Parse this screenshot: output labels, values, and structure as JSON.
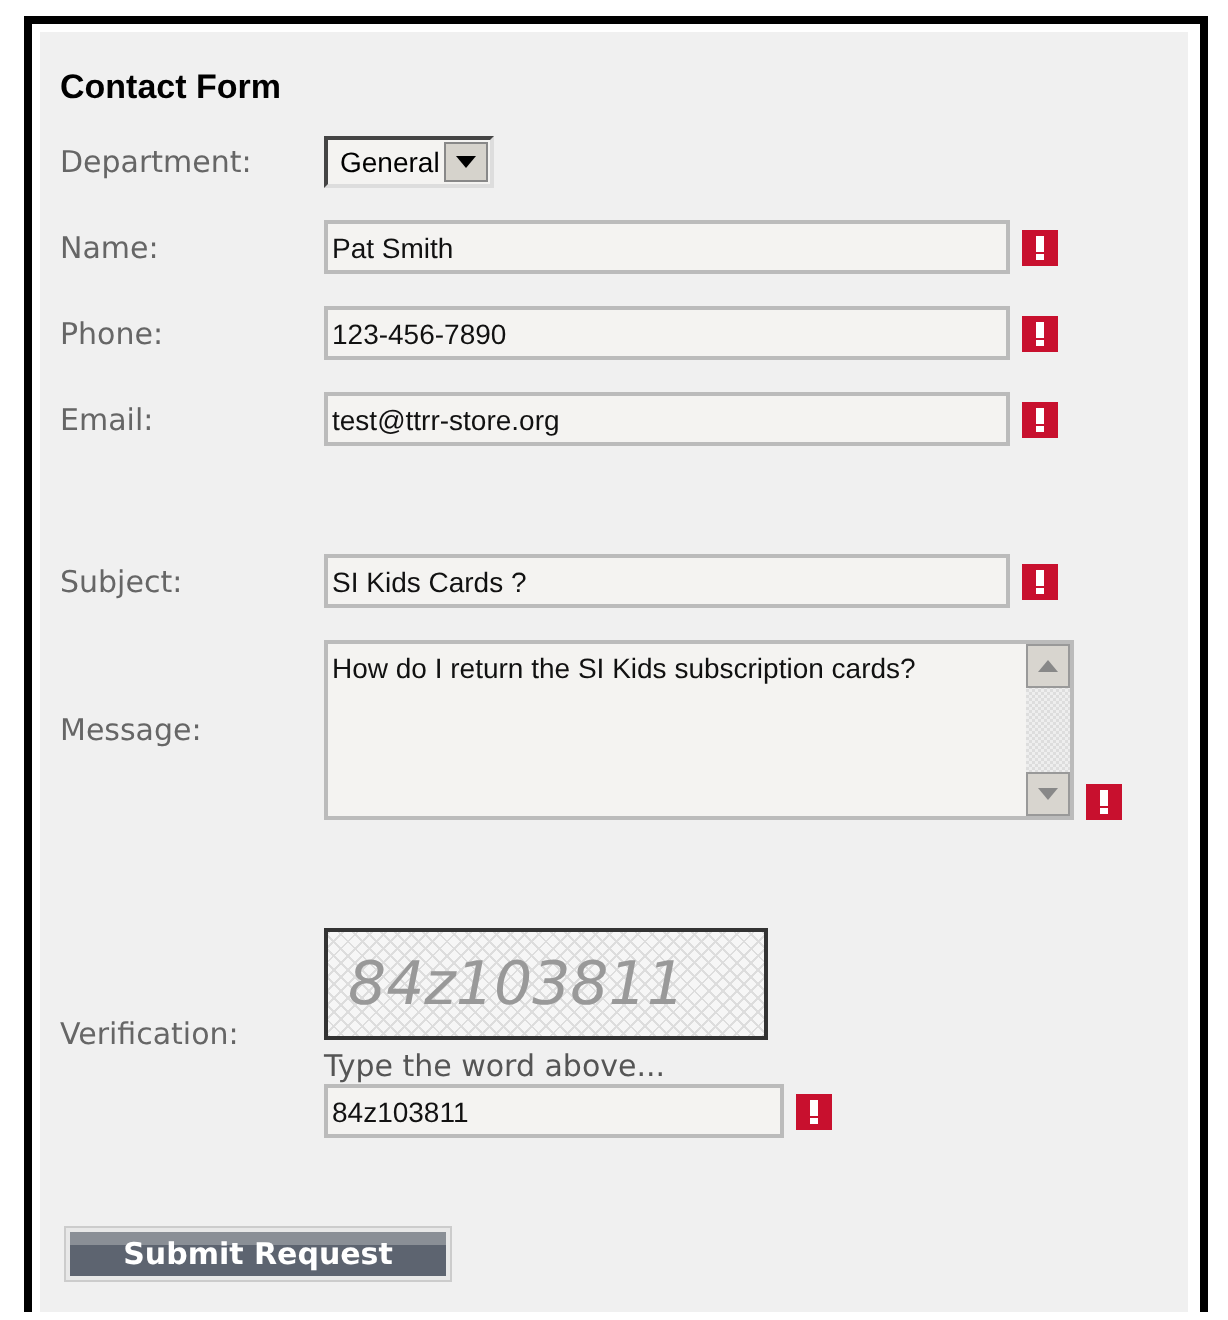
{
  "title": "Contact Form",
  "fields": [
    {
      "kind": "select",
      "label": "Department:",
      "value": "General"
    },
    {
      "kind": "text",
      "label": "Name:",
      "value": "Pat Smith",
      "error": true
    },
    {
      "kind": "text",
      "label": "Phone:",
      "value": "123-456-7890",
      "error": true
    },
    {
      "kind": "text",
      "label": "Email:",
      "value": "test@ttrr-store.org",
      "error": true
    },
    {
      "kind": "spacer"
    },
    {
      "kind": "text",
      "label": "Subject:",
      "value": "SI Kids Cards ?",
      "error": true
    },
    {
      "kind": "textarea",
      "label": "Message:",
      "value": "How do I return the SI Kids subscription cards?",
      "error": true
    },
    {
      "kind": "spacer"
    },
    {
      "kind": "captcha",
      "label": "Verification:",
      "captcha_text": "84z103811",
      "hint": "Type the word above...",
      "value": "84z103811",
      "error": true
    }
  ],
  "submit": "Submit Request"
}
